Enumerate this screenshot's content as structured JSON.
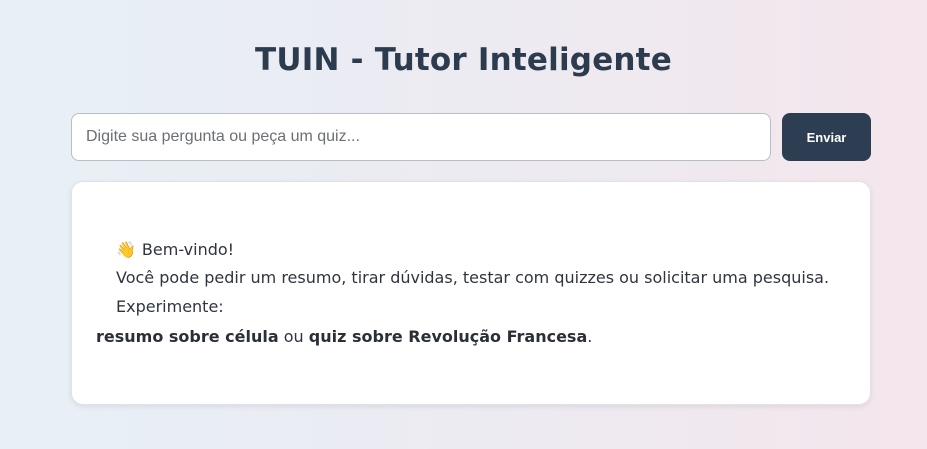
{
  "header": {
    "title": "TUIN - Tutor Inteligente"
  },
  "search": {
    "placeholder": "Digite sua pergunta ou peça um quiz...",
    "value": "",
    "send_label": "Enviar"
  },
  "chat": {
    "wave_icon": "waving-hand-icon",
    "wave_glyph": "👋",
    "greeting": "Bem-vindo!",
    "intro": "Você pode pedir um resumo, tirar dúvidas, testar com quizzes ou solicitar uma pesquisa.",
    "try_label": "Experimente:",
    "example_1": "resumo sobre célula",
    "connector": "ou",
    "example_2": "quiz sobre Revolução Francesa",
    "end_punct": "."
  },
  "colors": {
    "button_bg": "#2d3d52",
    "title_color": "#2d3b4e"
  }
}
